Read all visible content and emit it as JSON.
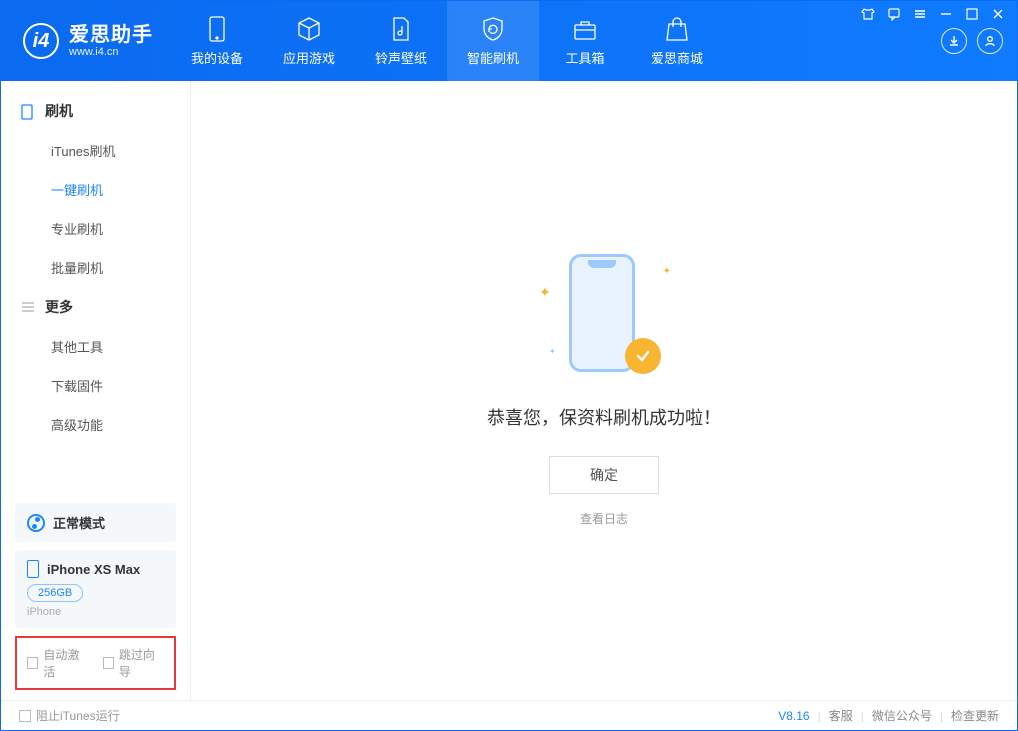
{
  "app": {
    "title": "爱思助手",
    "subtitle": "www.i4.cn"
  },
  "nav": {
    "items": [
      {
        "label": "我的设备"
      },
      {
        "label": "应用游戏"
      },
      {
        "label": "铃声壁纸"
      },
      {
        "label": "智能刷机"
      },
      {
        "label": "工具箱"
      },
      {
        "label": "爱思商城"
      }
    ]
  },
  "sidebar": {
    "group1": {
      "title": "刷机",
      "items": [
        {
          "label": "iTunes刷机"
        },
        {
          "label": "一键刷机"
        },
        {
          "label": "专业刷机"
        },
        {
          "label": "批量刷机"
        }
      ]
    },
    "group2": {
      "title": "更多",
      "items": [
        {
          "label": "其他工具"
        },
        {
          "label": "下载固件"
        },
        {
          "label": "高级功能"
        }
      ]
    },
    "mode": {
      "label": "正常模式"
    },
    "device": {
      "name": "iPhone XS Max",
      "storage": "256GB",
      "type": "iPhone"
    },
    "opts": {
      "auto_activate": "自动激活",
      "skip_guide": "跳过向导"
    }
  },
  "main": {
    "success_msg": "恭喜您，保资料刷机成功啦！",
    "ok_label": "确定",
    "log_link": "查看日志"
  },
  "footer": {
    "block_itunes": "阻止iTunes运行",
    "version": "V8.16",
    "links": {
      "service": "客服",
      "wechat": "微信公众号",
      "update": "检查更新"
    }
  }
}
